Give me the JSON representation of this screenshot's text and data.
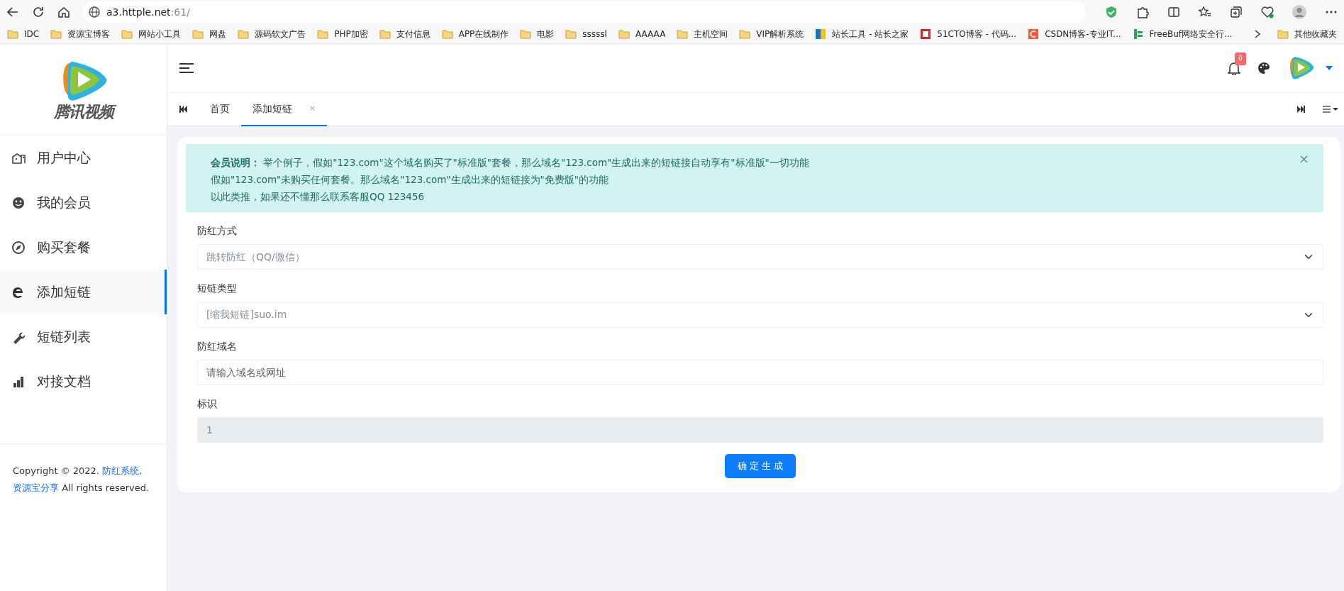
{
  "browser": {
    "address_host": "a3.httple.net",
    "address_rest": ":61/",
    "bookmarks": [
      {
        "kind": "folder",
        "label": "IDC"
      },
      {
        "kind": "folder",
        "label": "资源宝博客"
      },
      {
        "kind": "folder",
        "label": "网站小工具"
      },
      {
        "kind": "folder",
        "label": "网盘"
      },
      {
        "kind": "folder",
        "label": "源码软文广告"
      },
      {
        "kind": "folder",
        "label": "PHP加密"
      },
      {
        "kind": "folder",
        "label": "支付信息"
      },
      {
        "kind": "folder",
        "label": "APP在线制作"
      },
      {
        "kind": "folder",
        "label": "电影"
      },
      {
        "kind": "folder",
        "label": "sssssl"
      },
      {
        "kind": "folder",
        "label": "AAAAA"
      },
      {
        "kind": "folder",
        "label": "主机空间"
      },
      {
        "kind": "folder",
        "label": "VIP解析系统"
      },
      {
        "kind": "site",
        "label": "站长工具 - 站长之家"
      },
      {
        "kind": "site",
        "label": "51CTO博客 - 代码..."
      },
      {
        "kind": "site",
        "label": "CSDN博客-专业IT..."
      },
      {
        "kind": "site",
        "label": "FreeBuf网络安全行..."
      }
    ],
    "other_bookmarks": "其他收藏夹"
  },
  "sidebar": {
    "logo_text": "腾讯视频",
    "items": [
      {
        "label": "用户中心",
        "selected": false
      },
      {
        "label": "我的会员",
        "selected": false
      },
      {
        "label": "购买套餐",
        "selected": false
      },
      {
        "label": "添加短链",
        "selected": true
      },
      {
        "label": "短链列表",
        "selected": false
      },
      {
        "label": "对接文档",
        "selected": false
      }
    ],
    "copyright": "Copyright © 2022.",
    "links": [
      "防红系统,",
      "资源宝分享"
    ],
    "rights": "All rights reserved."
  },
  "header": {
    "notification_count": "0"
  },
  "tabs": [
    {
      "label": "首页",
      "selected": false
    },
    {
      "label": "添加短链",
      "selected": true,
      "close": "×"
    }
  ],
  "alert": {
    "lines": [
      "**会员说明：** 举个例子，假如\"123.com\"这个域名购买了\"标准版\"套餐，那么域名\"123.com\"生成出来的短链接自动享有\"标准版\"一切功能",
      "假如\"123.com\"未购买任何套餐。那么域名\"123.com\"生成出来的短链接为\"免费版\"的功能",
      "以此类推，如果还不懂那么联系客服QQ 123456"
    ],
    "close": "×"
  },
  "form": {
    "fields": [
      {
        "kind": "select",
        "label": "防红方式",
        "value": "跳转防红（QQ/微信）"
      },
      {
        "kind": "select",
        "label": "短链类型",
        "value": "[缩我短链]suo.im"
      },
      {
        "kind": "input",
        "label": "防红域名",
        "placeholder": "请输入域名或网址"
      },
      {
        "kind": "readonly",
        "label": "标识",
        "value": "1"
      }
    ],
    "submit": "确 定 生 成"
  }
}
